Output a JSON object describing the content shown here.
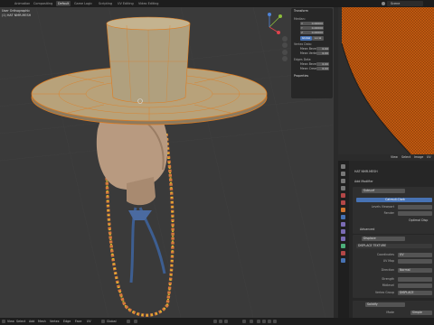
{
  "topbar": {
    "tabs": [
      "Animation",
      "Compositing",
      "Default",
      "Game Logic",
      "Scripting",
      "UV Editing",
      "Video Editing"
    ],
    "active_tab": "Default",
    "scene_label": "Scene"
  },
  "viewport": {
    "view_title": "User Orthographic",
    "object_name": "(1) HAT NMR.MESH"
  },
  "npanel": {
    "header": "Transform",
    "median": "Median:",
    "axes": [
      "X",
      "Y",
      "Z"
    ],
    "values": [
      "0.00000",
      "0.00000",
      "0.00000"
    ],
    "global": "Global",
    "local": "Local",
    "vertex_data": "Vertex Data:",
    "mean_bevel_label": "Mean Bevel",
    "mean_bevel": "0.00",
    "mean_vertex_label": "Mean Vertex",
    "mean_vertex": "0.00",
    "edge_data": "Edges Data:",
    "mean_bevel_2": "0.00",
    "mean_crease_label": "Mean Crease",
    "mean_crease": "0.00",
    "properties": "Properties"
  },
  "image_editor": {
    "menu": [
      "View",
      "Select",
      "Image",
      "UV"
    ]
  },
  "properties": {
    "object_name": "HAT NMR.MESH",
    "add_modifier": "Add Modifier",
    "subsurf": "Subsurf",
    "catmull_clark": "Catmull-Clark",
    "levels_viewport": "Levels Viewport",
    "render": "Render",
    "optimal_display": "Optimal Disp",
    "advanced": "Advanced",
    "displace": "Displace",
    "texture_name": "DISPLACE TEXTURE",
    "coordinates_label": "Coordinates",
    "coordinates": "UV",
    "uv_map_label": "UV Map",
    "direction_label": "Direction",
    "direction": "Normal",
    "strength_label": "Strength",
    "midlevel_label": "Midlevel",
    "vertex_group_label": "Vertex Group",
    "vertex_group": "DISPLACE",
    "solidify": "Solidify",
    "mode_label": "Mode",
    "mode": "Simple",
    "thickness_label": "Thickness"
  },
  "statusbar": {
    "menus": [
      "View",
      "Select",
      "Add",
      "Mesh",
      "Vertex",
      "Edge",
      "Face",
      "UV"
    ],
    "pivot": "Global"
  },
  "colors": {
    "viewport_bg": "#3a3a3a",
    "accent_blue": "#4772b3",
    "mesh_tan": "#b8a27a",
    "selected_orange": "#e07c1f",
    "texture_orange": "#c25a10"
  }
}
